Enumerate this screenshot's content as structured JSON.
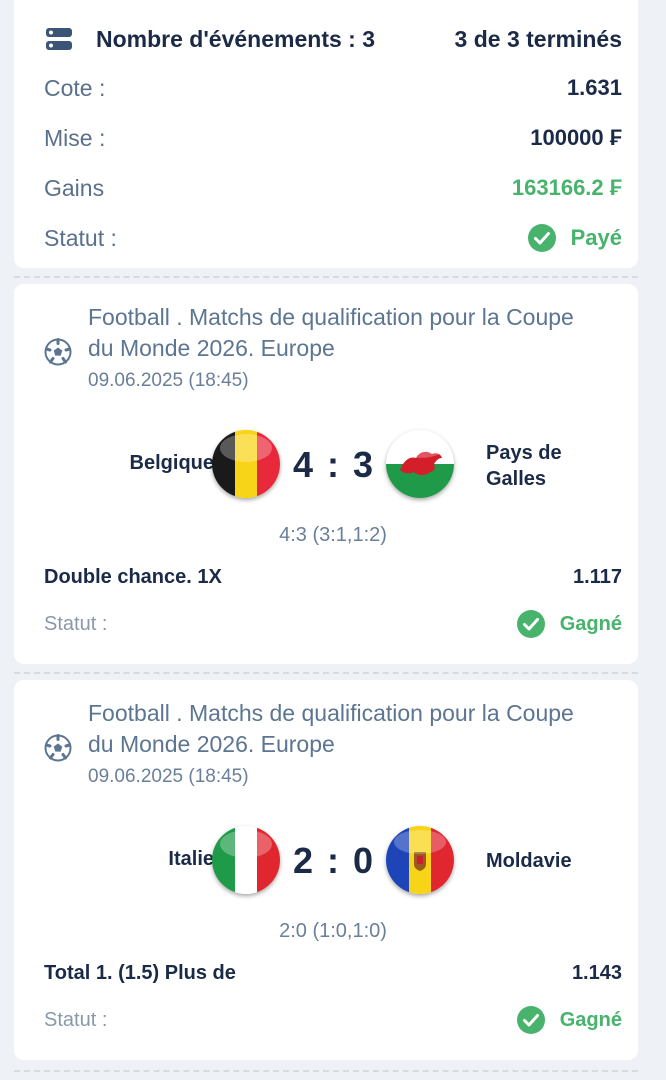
{
  "summary": {
    "events_label": "Nombre d'événements : 3",
    "completed": "3 de 3 terminés",
    "rows": [
      {
        "label": "Cote :",
        "value": "1.631"
      },
      {
        "label": "Mise :",
        "value": "100000 ₣"
      },
      {
        "label": "Gains",
        "value": "163166.2 ₣"
      }
    ],
    "status_label": "Statut :",
    "status_value": "Payé"
  },
  "events": [
    {
      "title": "Football . Matchs de qualification pour la Coupe du Monde 2026. Europe",
      "date": "09.06.2025 (18:45)",
      "team_a": "Belgique",
      "team_b": "Pays de Galles",
      "score": "4 : 3",
      "detail": "4:3 (3:1,1:2)",
      "bet": "Double chance. 1X",
      "odds": "1.117",
      "status_label": "Statut :",
      "status": "Gagné",
      "flags": [
        "belgium-flag-icon",
        "wales-flag-icon"
      ]
    },
    {
      "title": "Football . Matchs de qualification pour la Coupe du Monde 2026. Europe",
      "date": "09.06.2025 (18:45)",
      "team_a": "Italie",
      "team_b": "Moldavie",
      "score": "2 : 0",
      "detail": "2:0 (1:0,1:0)",
      "bet": "Total 1. (1.5) Plus de",
      "odds": "1.143",
      "status_label": "Statut :",
      "status": "Gagné",
      "flags": [
        "italy-flag-icon",
        "moldova-flag-icon"
      ]
    }
  ],
  "colors": {
    "navy": "#1b2a46",
    "label": "#5a708c",
    "green": "#47b36c",
    "background": "#eef1f5"
  }
}
